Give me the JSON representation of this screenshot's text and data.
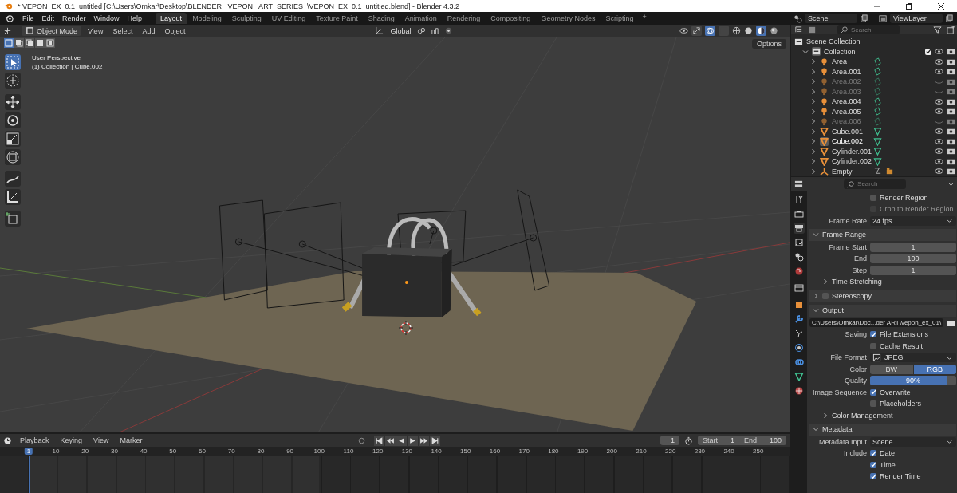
{
  "window": {
    "title": "* VEPON_EX_0.1_untitled [C:\\Users\\Omkar\\Desktop\\BLENDER_ VEPON_ ART_SERIES_\\VEPON_EX_0.1_untitled.blend] - Blender 4.3.2"
  },
  "menu": [
    "File",
    "Edit",
    "Render",
    "Window",
    "Help"
  ],
  "workspaces": [
    {
      "label": "Layout",
      "selected": true
    },
    {
      "label": "Modeling",
      "selected": false
    },
    {
      "label": "Sculpting",
      "selected": false
    },
    {
      "label": "UV Editing",
      "selected": false
    },
    {
      "label": "Texture Paint",
      "selected": false
    },
    {
      "label": "Shading",
      "selected": false
    },
    {
      "label": "Animation",
      "selected": false
    },
    {
      "label": "Rendering",
      "selected": false
    },
    {
      "label": "Compositing",
      "selected": false
    },
    {
      "label": "Geometry Nodes",
      "selected": false
    },
    {
      "label": "Scripting",
      "selected": false
    }
  ],
  "add_workspace": "+",
  "scene": "Scene",
  "view_layer": "ViewLayer",
  "viewport": {
    "mode": "Object Mode",
    "menus": [
      "View",
      "Select",
      "Add",
      "Object"
    ],
    "orientation": "Global",
    "options": "Options",
    "overlay_lines": [
      "User Perspective",
      "(1) Collection | Cube.002"
    ]
  },
  "outliner": {
    "search_placeholder": "Search",
    "root": "Scene Collection",
    "collection": {
      "label": "Collection",
      "checked": true,
      "expanded": true
    },
    "items": [
      {
        "name": "Area",
        "kind": "light",
        "visible": true,
        "selected": false
      },
      {
        "name": "Area.001",
        "kind": "light",
        "visible": true,
        "selected": false
      },
      {
        "name": "Area.002",
        "kind": "light",
        "visible": false,
        "selected": false
      },
      {
        "name": "Area.003",
        "kind": "light",
        "visible": false,
        "selected": false
      },
      {
        "name": "Area.004",
        "kind": "light",
        "visible": true,
        "selected": false
      },
      {
        "name": "Area.005",
        "kind": "light",
        "visible": true,
        "selected": false
      },
      {
        "name": "Area.006",
        "kind": "light",
        "visible": false,
        "selected": false
      },
      {
        "name": "Cube.001",
        "kind": "mesh",
        "visible": true,
        "selected": false
      },
      {
        "name": "Cube.002",
        "kind": "mesh",
        "visible": true,
        "selected": true
      },
      {
        "name": "Cylinder.001",
        "kind": "mesh",
        "visible": true,
        "selected": false
      },
      {
        "name": "Cylinder.002",
        "kind": "mesh",
        "visible": true,
        "selected": false
      },
      {
        "name": "Empty",
        "kind": "empty",
        "visible": true,
        "selected": false
      }
    ]
  },
  "properties": {
    "search_placeholder": "Search",
    "rows": [
      {
        "kind": "checkbox",
        "label": "Render Region",
        "checked": false,
        "disabled": false
      },
      {
        "kind": "checkbox",
        "label": "Crop to Render Region",
        "checked": false,
        "disabled": true
      },
      {
        "kind": "dropdown",
        "label": "Frame Rate",
        "value": "24 fps"
      },
      {
        "kind": "panel",
        "label": "Frame Range",
        "expanded": true
      },
      {
        "kind": "number",
        "label": "Frame Start",
        "value": "1"
      },
      {
        "kind": "number",
        "label": "End",
        "value": "100"
      },
      {
        "kind": "number",
        "label": "Step",
        "value": "1"
      },
      {
        "kind": "subpanel",
        "label": "Time Stretching",
        "expanded": false
      },
      {
        "kind": "panel",
        "label": "Stereoscopy",
        "expanded": false,
        "checked": false
      },
      {
        "kind": "panel",
        "label": "Output",
        "expanded": true
      },
      {
        "kind": "path",
        "value": "C:\\Users\\Omkar\\Doc...der ART\\vepon_ex_01\\"
      },
      {
        "kind": "checkbox",
        "caption": "Saving",
        "label": "File Extensions",
        "checked": true,
        "disabled": false
      },
      {
        "kind": "checkbox",
        "label": "Cache Result",
        "checked": false,
        "disabled": false
      },
      {
        "kind": "image_dropdown",
        "label": "File Format",
        "value": "JPEG"
      },
      {
        "kind": "toggle",
        "label": "Color",
        "options": [
          {
            "label": "BW",
            "selected": false
          },
          {
            "label": "RGB",
            "selected": true
          }
        ]
      },
      {
        "kind": "slider",
        "label": "Quality",
        "value": "90%",
        "level": 0.9
      },
      {
        "kind": "checkbox",
        "caption": "Image Sequence",
        "label": "Overwrite",
        "checked": true,
        "disabled": false
      },
      {
        "kind": "checkbox",
        "label": "Placeholders",
        "checked": false,
        "disabled": false
      },
      {
        "kind": "subpanel",
        "label": "Color Management",
        "expanded": false
      },
      {
        "kind": "panel",
        "label": "Metadata",
        "expanded": true
      },
      {
        "kind": "dropdown",
        "label": "Metadata Input",
        "value": "Scene"
      },
      {
        "kind": "checkbox",
        "caption": "Include",
        "label": "Date",
        "checked": true,
        "disabled": false
      },
      {
        "kind": "checkbox",
        "label": "Time",
        "checked": true,
        "disabled": false
      },
      {
        "kind": "checkbox",
        "label": "Render Time",
        "checked": true,
        "disabled": false
      }
    ]
  },
  "timeline": {
    "menus": [
      "Playback",
      "Keying",
      "View",
      "Marker"
    ],
    "current_frame": "1",
    "start_label": "Start",
    "start": "1",
    "end_label": "End",
    "end": "100",
    "ticks": [
      "1",
      "10",
      "20",
      "30",
      "40",
      "50",
      "60",
      "70",
      "80",
      "90",
      "100",
      "110",
      "120",
      "130",
      "140",
      "150",
      "160",
      "170",
      "180",
      "190",
      "200",
      "210",
      "220",
      "230",
      "240",
      "250"
    ]
  }
}
